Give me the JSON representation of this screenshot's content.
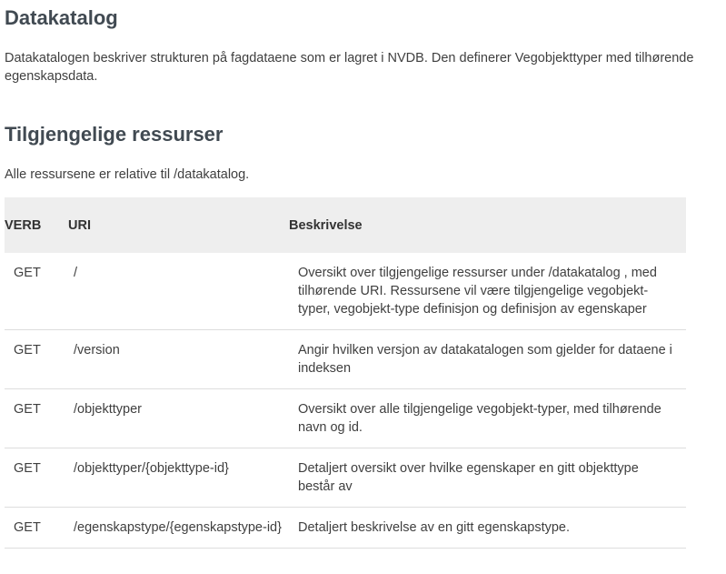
{
  "header": {
    "title": "Datakatalog",
    "intro": "Datakatalogen beskriver strukturen på fagdataene som er lagret i NVDB. Den definerer Vegobjekttyper med tilhørende egenskapsdata."
  },
  "resources": {
    "title": "Tilgjengelige ressurser",
    "note": "Alle ressursene er relative til /datakatalog.",
    "columns": {
      "verb": "VERB",
      "uri": "URI",
      "description": "Beskrivelse"
    },
    "rows": [
      {
        "verb": "GET",
        "uri": "/",
        "description": "Oversikt over tilgjengelige ressurser under /datakatalog , med tilhørende URI. Ressursene vil være tilgjengelige vegobjekt-typer, vegobjekt-type definisjon og definisjon av egenskaper"
      },
      {
        "verb": "GET",
        "uri": "/version",
        "description": "Angir hvilken versjon av datakatalogen som gjelder for dataene i indeksen"
      },
      {
        "verb": "GET",
        "uri": "/objekttyper",
        "description": "Oversikt over alle tilgjengelige vegobjekt-typer, med tilhørende navn og id."
      },
      {
        "verb": "GET",
        "uri": "/objekttyper/{objekttype-id}",
        "description": "Detaljert oversikt over hvilke egenskaper en gitt objekttype består av"
      },
      {
        "verb": "GET",
        "uri": "/egenskapstype/{egenskapstype-id}",
        "description": "Detaljert beskrivelse av en gitt egenskapstype."
      }
    ]
  }
}
